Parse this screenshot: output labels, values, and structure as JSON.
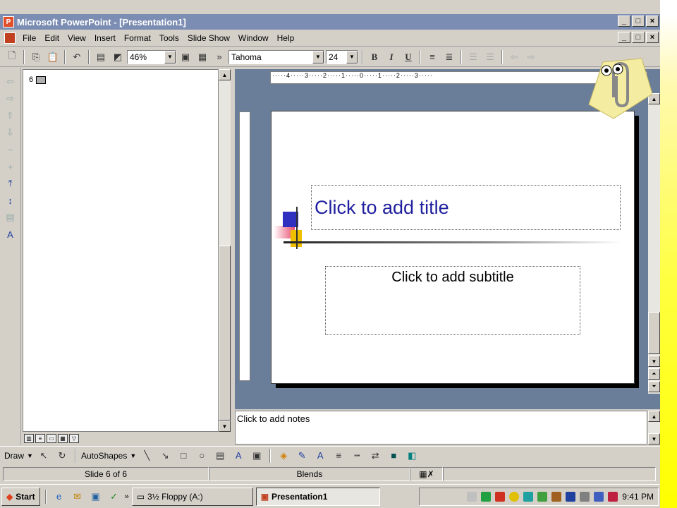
{
  "window": {
    "title": "Microsoft PowerPoint - [Presentation1]",
    "app_icon": "powerpoint-icon",
    "caption_min": "_",
    "caption_max": "□",
    "caption_close": "×"
  },
  "menu": {
    "items": [
      "File",
      "Edit",
      "View",
      "Insert",
      "Format",
      "Tools",
      "Slide Show",
      "Window",
      "Help"
    ]
  },
  "toolbar": {
    "zoom": "46%",
    "font_name": "Tahoma",
    "font_size": "24",
    "bold": "B",
    "italic": "I",
    "underline": "U",
    "overflow": "»"
  },
  "outline": {
    "slide_number": "6"
  },
  "ruler": {
    "horizontal": "·····4·····3·····2·····1·····0·····1·····2·····3·····"
  },
  "slide": {
    "title_placeholder": "Click to add title",
    "subtitle_placeholder": "Click to add subtitle"
  },
  "notes": {
    "placeholder": "Click to add notes"
  },
  "drawbar": {
    "draw_label": "Draw",
    "autoshapes_label": "AutoShapes"
  },
  "status": {
    "slide_info": "Slide 6 of 6",
    "design": "Blends"
  },
  "taskbar": {
    "start_label": "Start",
    "floppy_label": "3½ Floppy (A:)",
    "presentation_label": "Presentation1",
    "clock": "9:41 PM"
  }
}
